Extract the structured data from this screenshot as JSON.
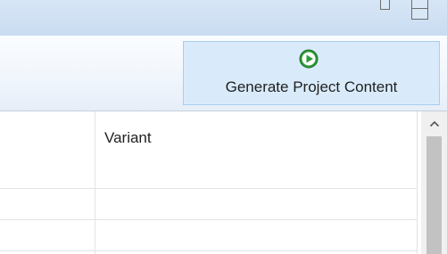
{
  "toolbar": {
    "generate_button_label": "Generate Project Content",
    "generate_icon": "play-circle-icon",
    "accent_color": "#2e9b39"
  },
  "table": {
    "columns": [
      "",
      "Variant"
    ],
    "rows": [
      [
        "",
        ""
      ],
      [
        "",
        ""
      ]
    ]
  },
  "window": {
    "controls": [
      "minimize-icon",
      "maximize-icon"
    ]
  },
  "scrollbar": {
    "up_icon": "chevron-up-icon"
  }
}
